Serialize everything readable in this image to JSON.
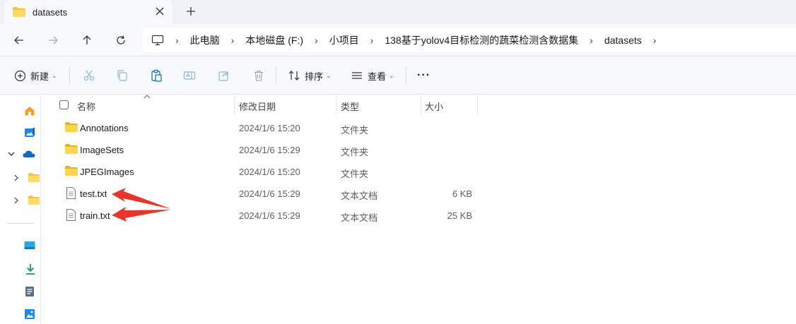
{
  "tab": {
    "title": "datasets",
    "close_glyph": "✕",
    "new_tab_glyph": "+"
  },
  "breadcrumb": [
    "此电脑",
    "本地磁盘 (F:)",
    "小项目",
    "138基于yolov4目标检测的蔬菜检测含数据集",
    "datasets"
  ],
  "toolbar": {
    "new_label": "新建",
    "sort_label": "排序",
    "view_label": "查看",
    "more_label": "···"
  },
  "columns": {
    "name": "名称",
    "date": "修改日期",
    "type": "类型",
    "size": "大小"
  },
  "files": [
    {
      "name": "Annotations",
      "date": "2024/1/6 15:20",
      "type": "文件夹",
      "size": "",
      "icon": "folder-icon"
    },
    {
      "name": "ImageSets",
      "date": "2024/1/6 15:29",
      "type": "文件夹",
      "size": "",
      "icon": "folder-icon"
    },
    {
      "name": "JPEGImages",
      "date": "2024/1/6 15:20",
      "type": "文件夹",
      "size": "",
      "icon": "folder-icon"
    },
    {
      "name": "test.txt",
      "date": "2024/1/6 15:29",
      "type": "文本文档",
      "size": "6 KB",
      "icon": "text-file-icon"
    },
    {
      "name": "train.txt",
      "date": "2024/1/6 15:29",
      "type": "文本文档",
      "size": "25 KB",
      "icon": "text-file-icon"
    }
  ],
  "colors": {
    "accent": "#0067c0",
    "folder": "#f4c430",
    "annotation_arrow": "#e8352b"
  }
}
